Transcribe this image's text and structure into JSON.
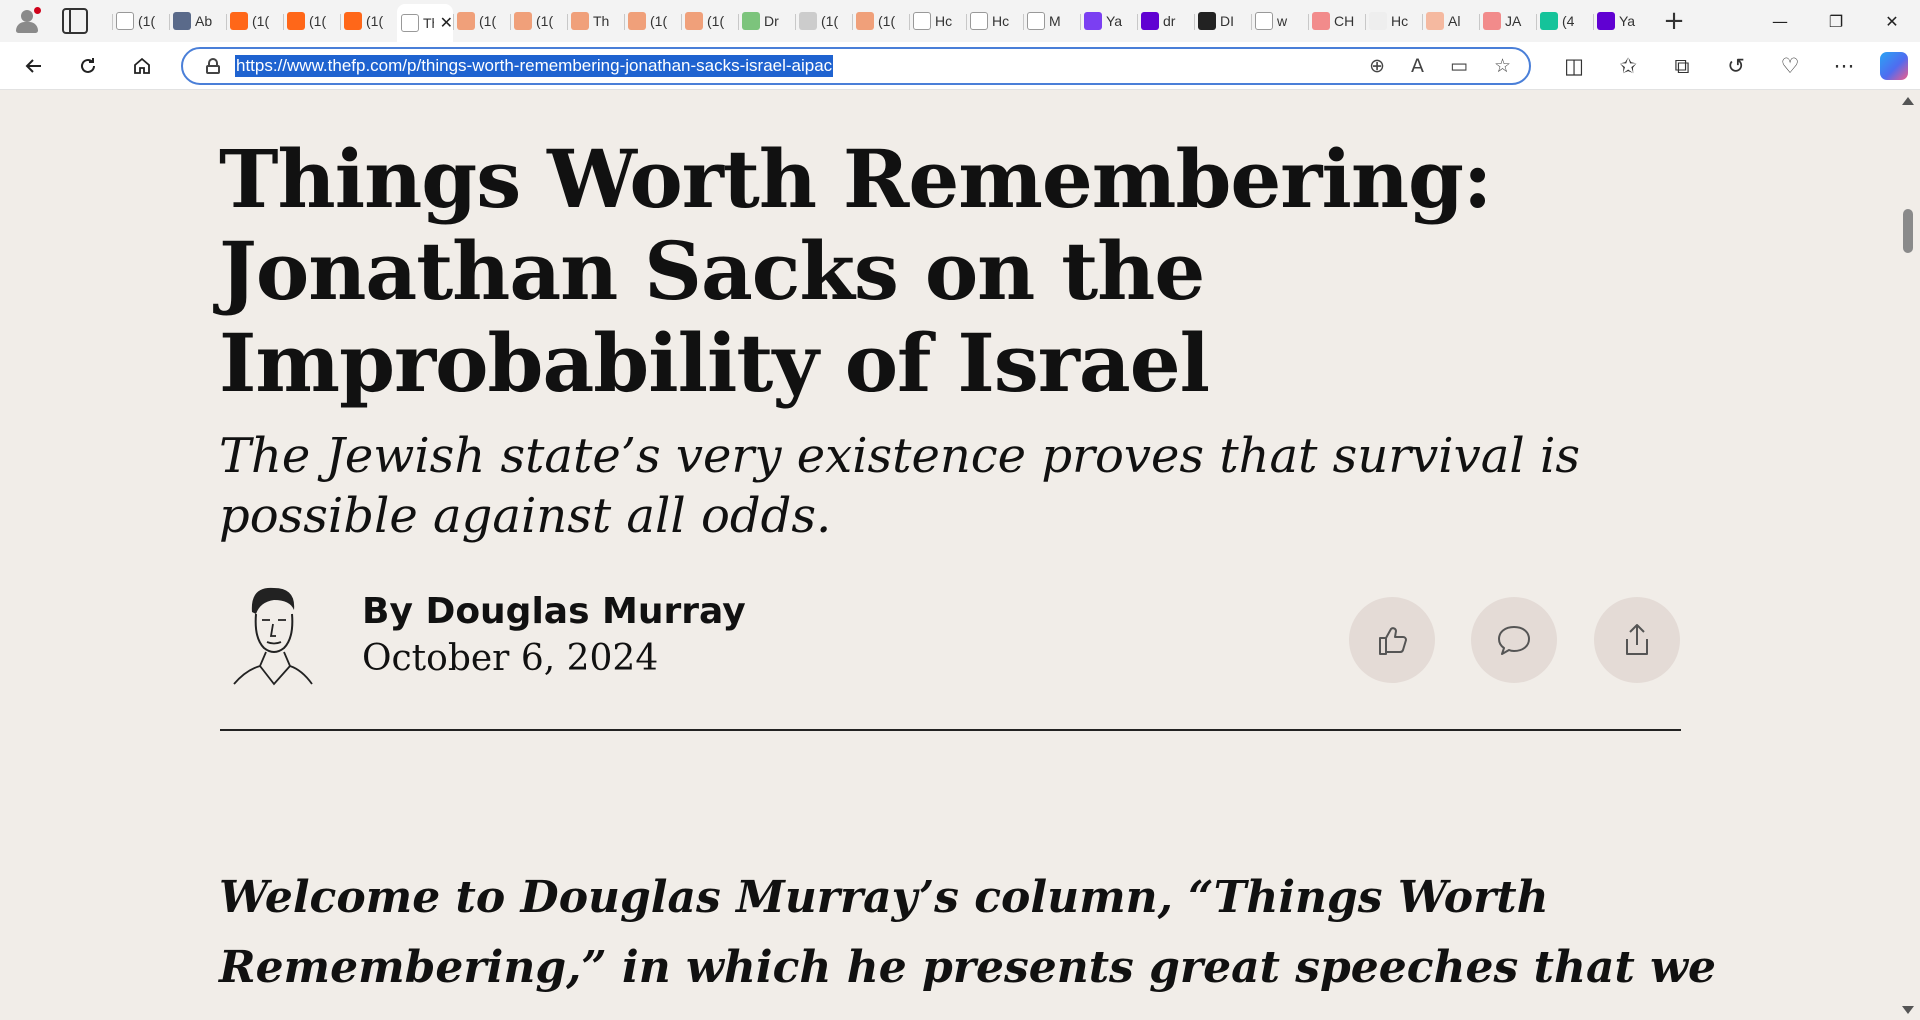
{
  "browser": {
    "tabs": [
      {
        "label": "(1(",
        "icon": "page-icon",
        "color": "#ffffff"
      },
      {
        "label": "Ab",
        "icon": "va-icon",
        "color": "#5a6a8a"
      },
      {
        "label": "(1(",
        "icon": "substack-icon",
        "color": "#ff6719"
      },
      {
        "label": "(1(",
        "icon": "substack-icon",
        "color": "#ff6719"
      },
      {
        "label": "(1(",
        "icon": "substack-icon",
        "color": "#ff6719"
      },
      {
        "label": "Th",
        "icon": "fp-icon",
        "color": "#ffffff",
        "active": true
      },
      {
        "label": "(1(",
        "icon": "bookmark-icon",
        "color": "#f0a07a"
      },
      {
        "label": "(1(",
        "icon": "bookmark-icon",
        "color": "#f0a07a"
      },
      {
        "label": "Th",
        "icon": "bookmark-icon",
        "color": "#f0a07a"
      },
      {
        "label": "(1(",
        "icon": "bookmark-icon",
        "color": "#f0a07a"
      },
      {
        "label": "(1(",
        "icon": "bookmark-icon",
        "color": "#f0a07a"
      },
      {
        "label": "Dr",
        "icon": "play-icon",
        "color": "#7cc47c"
      },
      {
        "label": "(1(",
        "icon": "image-icon",
        "color": "#cccccc"
      },
      {
        "label": "(1(",
        "icon": "bookmark-icon",
        "color": "#f0a07a"
      },
      {
        "label": "Hc",
        "icon": "page-icon",
        "color": "#ffffff"
      },
      {
        "label": "Hc",
        "icon": "page-icon",
        "color": "#ffffff"
      },
      {
        "label": "M",
        "icon": "search-icon",
        "color": "#ffffff"
      },
      {
        "label": "Ya",
        "icon": "yahoo-icon",
        "color": "#7b3ff2"
      },
      {
        "label": "dr",
        "icon": "yahoo-icon",
        "color": "#6001d2"
      },
      {
        "label": "DI",
        "icon": "dr-icon",
        "color": "#222222"
      },
      {
        "label": "w",
        "icon": "audio-icon",
        "color": "#ffffff"
      },
      {
        "label": "CH",
        "icon": "youtube-icon",
        "color": "#f28b8b"
      },
      {
        "label": "Hc",
        "icon": "bird-icon",
        "color": "#eeeeee"
      },
      {
        "label": "Al",
        "icon": "b-icon",
        "color": "#f5b9a0"
      },
      {
        "label": "JA",
        "icon": "youtube-icon",
        "color": "#f28b8b"
      },
      {
        "label": "(4",
        "icon": "g-icon",
        "color": "#15c39a"
      },
      {
        "label": "Ya",
        "icon": "yahoo-icon",
        "color": "#6001d2"
      }
    ],
    "new_tab": "+",
    "window": {
      "minimize": "—",
      "restore": "❐",
      "close": "✕"
    },
    "url": "https://www.thefp.com/p/things-worth-remembering-jonathan-sacks-israel-aipac"
  },
  "article": {
    "title": "Things Worth Remembering: Jonathan Sacks on the Improbability of Israel",
    "subtitle": "The Jewish state’s very existence proves that survival is possible against all odds.",
    "byline": "By Douglas Murray",
    "date": "October 6, 2024",
    "intro": "Welcome to Douglas Murray’s column, “Things Worth Remembering,” in which he presents great speeches that we"
  },
  "colors": {
    "page_bg": "#f1ede8",
    "button_bg": "#e4dbd6",
    "accent": "#1f63d0"
  }
}
